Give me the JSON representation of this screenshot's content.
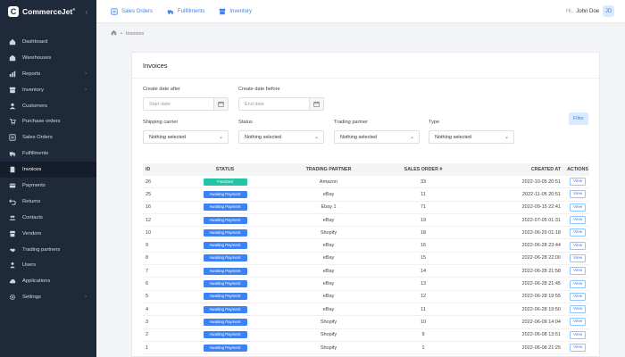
{
  "app": {
    "brand": "CommerceJet",
    "brand_mark": "®",
    "logo_letter": "C",
    "collapse_glyph": "‹"
  },
  "sidebar": {
    "items": [
      {
        "label": "Dashboard",
        "icon": "dashboard-icon",
        "chevron": false,
        "active": false
      },
      {
        "label": "Warehouses",
        "icon": "warehouse-icon",
        "chevron": false,
        "active": false
      },
      {
        "label": "Reports",
        "icon": "chart-icon",
        "chevron": true,
        "active": false
      },
      {
        "label": "Inventory",
        "icon": "inventory-icon",
        "chevron": true,
        "active": false
      },
      {
        "label": "Customers",
        "icon": "users-icon",
        "chevron": false,
        "active": false
      },
      {
        "label": "Purchase orders",
        "icon": "cart-icon",
        "chevron": false,
        "active": false
      },
      {
        "label": "Sales Orders",
        "icon": "sales-icon",
        "chevron": false,
        "active": false
      },
      {
        "label": "Fulfillments",
        "icon": "truck-icon",
        "chevron": false,
        "active": false
      },
      {
        "label": "Invoices",
        "icon": "invoice-icon",
        "chevron": false,
        "active": true
      },
      {
        "label": "Payments",
        "icon": "payment-icon",
        "chevron": false,
        "active": false
      },
      {
        "label": "Returns",
        "icon": "return-icon",
        "chevron": false,
        "active": false
      },
      {
        "label": "Contacts",
        "icon": "contacts-icon",
        "chevron": false,
        "active": false
      },
      {
        "label": "Vendors",
        "icon": "vendor-icon",
        "chevron": false,
        "active": false
      },
      {
        "label": "Trading partners",
        "icon": "handshake-icon",
        "chevron": false,
        "active": false
      },
      {
        "label": "Users",
        "icon": "user-group-icon",
        "chevron": false,
        "active": false
      },
      {
        "label": "Applications",
        "icon": "cloud-icon",
        "chevron": false,
        "active": false
      },
      {
        "label": "Settings",
        "icon": "gear-icon",
        "chevron": true,
        "active": false
      }
    ],
    "chevron_glyph": "›"
  },
  "topbar": {
    "links": [
      {
        "label": "Sales Orders",
        "icon": "sales-icon"
      },
      {
        "label": "Fulfillments",
        "icon": "truck-icon"
      },
      {
        "label": "Inventory",
        "icon": "inventory-icon"
      }
    ],
    "greeting": "Hi,",
    "user_name": "John Doe",
    "avatar_initials": "JD"
  },
  "breadcrumb": {
    "separator": "•",
    "current": "Invoices"
  },
  "page": {
    "title": "Invoices",
    "filters": {
      "created_after_label": "Create date after",
      "created_after_placeholder": "Start date",
      "created_before_label": "Create date before",
      "created_before_placeholder": "End date",
      "carrier_label": "Shipping carrier",
      "carrier_value": "Nothing selected",
      "status_label": "Status",
      "status_value": "Nothing selected",
      "partner_label": "Trading partner",
      "partner_value": "Nothing selected",
      "type_label": "Type",
      "type_value": "Nothing selected",
      "filter_button": "Filter",
      "select_chevron": "⌄"
    },
    "table": {
      "headers": {
        "id": "ID",
        "status": "STATUS",
        "partner": "TRADING PARTNER",
        "sales_order": "SALES ORDER #",
        "created": "CREATED AT",
        "actions": "ACTIONS"
      },
      "view_label": "View",
      "rows": [
        {
          "id": "26",
          "status": "Finalized",
          "kind": "finalized",
          "partner": "Amazon",
          "so": "33",
          "created": "2022-10-05 20:51"
        },
        {
          "id": "25",
          "status": "Awaiting Payment",
          "kind": "awaiting",
          "partner": "eBay",
          "so": "11",
          "created": "2022-11-05 20:51"
        },
        {
          "id": "16",
          "status": "Awaiting Payment",
          "kind": "awaiting",
          "partner": "Ebay 1",
          "so": "71",
          "created": "2022-09-15 22:41"
        },
        {
          "id": "12",
          "status": "Awaiting Payment",
          "kind": "awaiting",
          "partner": "eBay",
          "so": "19",
          "created": "2022-07-05 01:31"
        },
        {
          "id": "10",
          "status": "Awaiting Payment",
          "kind": "awaiting",
          "partner": "Shopify",
          "so": "18",
          "created": "2022-06-29 01:18"
        },
        {
          "id": "9",
          "status": "Awaiting Payment",
          "kind": "awaiting",
          "partner": "eBay",
          "so": "16",
          "created": "2022-06-28 23:44"
        },
        {
          "id": "8",
          "status": "Awaiting Payment",
          "kind": "awaiting",
          "partner": "eBay",
          "so": "15",
          "created": "2022-06-28 22:00"
        },
        {
          "id": "7",
          "status": "Awaiting Payment",
          "kind": "awaiting",
          "partner": "eBay",
          "so": "14",
          "created": "2022-06-28 21:58"
        },
        {
          "id": "6",
          "status": "Awaiting Payment",
          "kind": "awaiting",
          "partner": "eBay",
          "so": "13",
          "created": "2022-06-28 21:45"
        },
        {
          "id": "5",
          "status": "Awaiting Payment",
          "kind": "awaiting",
          "partner": "eBay",
          "so": "12",
          "created": "2022-06-28 19:55"
        },
        {
          "id": "4",
          "status": "Awaiting Payment",
          "kind": "awaiting",
          "partner": "eBay",
          "so": "11",
          "created": "2022-06-28 19:50"
        },
        {
          "id": "3",
          "status": "Awaiting Payment",
          "kind": "awaiting",
          "partner": "Shopify",
          "so": "10",
          "created": "2022-06-09 14:04"
        },
        {
          "id": "2",
          "status": "Awaiting Payment",
          "kind": "awaiting",
          "partner": "Shopify",
          "so": "9",
          "created": "2022-06-08 13:51"
        },
        {
          "id": "1",
          "status": "Awaiting Payment",
          "kind": "awaiting",
          "partner": "Shopify",
          "so": "1",
          "created": "2022-06-08 21:25"
        }
      ]
    }
  },
  "colors": {
    "sidebar_bg": "#1e2a3a",
    "accent": "#3b82f6",
    "finalized": "#22c3a6"
  }
}
